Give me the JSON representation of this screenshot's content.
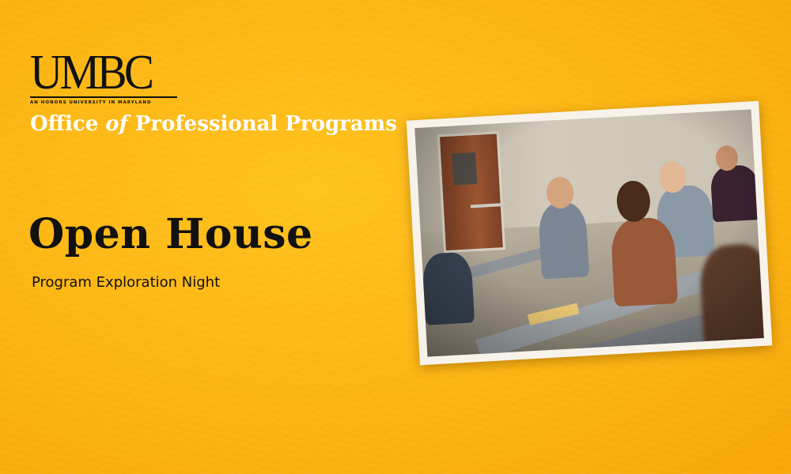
{
  "logo": {
    "wordmark": "UMBC",
    "tagline": "AN HONORS UNIVERSITY IN MARYLAND"
  },
  "department": {
    "part1": "Office ",
    "part2": "of",
    "part3": " Professional Programs"
  },
  "headline": "Open House",
  "subheadline": "Program Exploration Night",
  "colors": {
    "background": "#fcb512",
    "headline": "#111111",
    "department": "#ffffff"
  }
}
